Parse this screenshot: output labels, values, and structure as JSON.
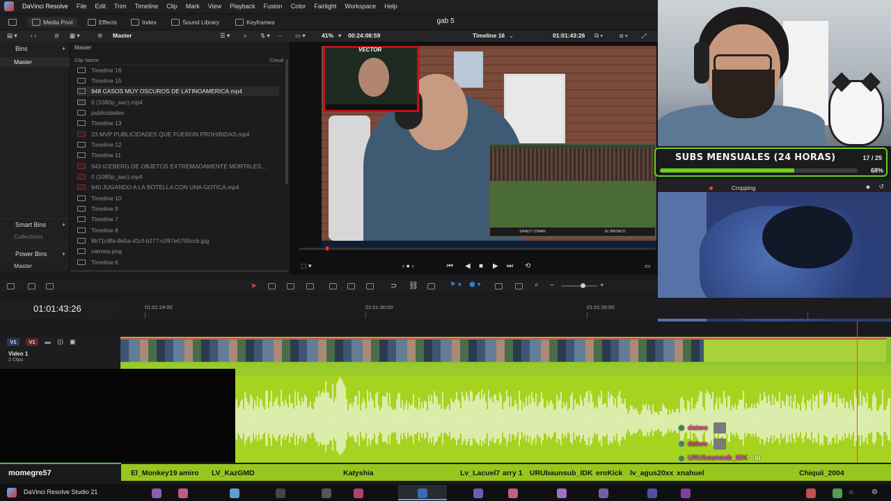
{
  "menu": {
    "app": "DaVinci Resolve",
    "items": [
      "File",
      "Edit",
      "Trim",
      "Timeline",
      "Clip",
      "Mark",
      "View",
      "Playback",
      "Fusion",
      "Color",
      "Fairlight",
      "Workspace",
      "Help"
    ]
  },
  "toolbar": {
    "media_pool": "Media Pool",
    "effects": "Effects",
    "index": "Index",
    "sound_library": "Sound Library",
    "keyframes": "Keyframes",
    "project_title": "gab 5"
  },
  "subbar": {
    "master": "Master",
    "zoom": "41%",
    "source_tc": "00:24:08:59",
    "timeline_name": "Timeline 16",
    "record_tc": "01:01:43:26"
  },
  "bins": {
    "header": "Bins",
    "master": "Master",
    "smart_bins": "Smart Bins",
    "collections": "Collections",
    "power_bins": "Power Bins",
    "power_master": "Master"
  },
  "cliplist": {
    "path": "Master",
    "col_name": "Clip Name",
    "col_cloud": "Cloud",
    "clips": [
      "Timeline 16",
      "Timeline 15",
      "948 CASOS MUY OSCUROS DE LATINOAMERICA.mp4",
      "0 (1080p_aac).mp4",
      "publicidades",
      "Timeline 13",
      "23 MVP PUBLICIDADES QUE FUERON PROHIBIDAS.mp4",
      "Timeline 12",
      "Timeline 11",
      "943 ICEBERG DE OBJETOS EXTREMADAMENTE MORTALES....",
      "0 (1080p_aac).mp4",
      "940 JUGANDO A LA BOTELLA CON UNA GOTICA.mp4",
      "Timeline 10",
      "Timeline 9",
      "Timeline 7",
      "Timeline 8",
      "8b71c8fa-8e5a-41cf-b277-c097e0700ccb.jpg",
      "viernes.png",
      "Timeline 6"
    ]
  },
  "viewer": {
    "cam_tag": "VECTOR",
    "game_left": "DANUT COMAN",
    "game_right": "GL BRONCO"
  },
  "overlay": {
    "subs_title": "SUBS MENSUALES (24 HORAS)",
    "subs_count": "17 / 25",
    "subs_pct_label": "68%",
    "subs_fraction": 0.68
  },
  "inspector": {
    "label": "Cropping"
  },
  "timeline": {
    "timecode": "01:01:43:26",
    "ticks": [
      "01:01:24:00",
      "01:01:30:00",
      "01:01:36:00"
    ],
    "v1_left": "V1",
    "v1_right": "V1",
    "track_name": "Video 1",
    "track_clips": "2 Clips"
  },
  "chat": [
    {
      "user": "datwo",
      "msg": ""
    },
    {
      "user": "datwo",
      "msg": ""
    },
    {
      "user": "URUbaunsub_IDK",
      "msg": ": si"
    }
  ],
  "names": {
    "left": "momegre57",
    "list": [
      "El_Monkey19",
      "amiro",
      "LV_KazGMD",
      "Katyshia",
      "Lv_Lacuel7",
      "arry 1",
      "URUbaunsub_IDK",
      "eroKick",
      "lv_agus20xx",
      "xnahuel",
      "Chiquii_2004"
    ]
  },
  "taskbar": {
    "app": "DaVinci Resolve Studio 21"
  },
  "colors": {
    "accent_green": "#6bd11b",
    "timeline_green": "#a6d31f",
    "playhead": "#e64a3a"
  }
}
